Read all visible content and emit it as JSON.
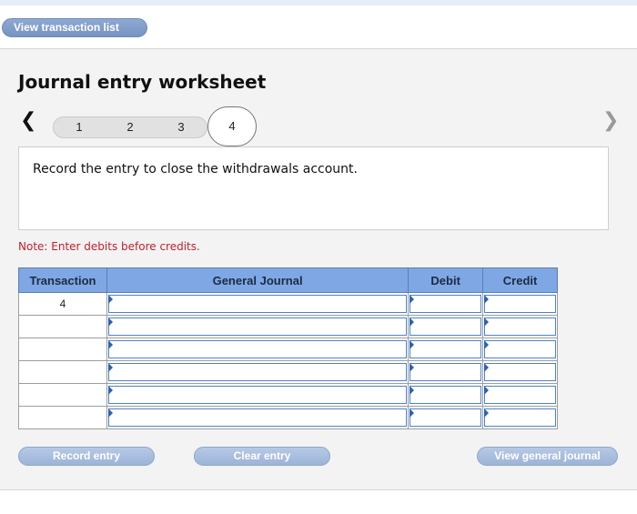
{
  "toolbar": {
    "view_transaction_list": "View transaction list"
  },
  "worksheet": {
    "title": "Journal entry worksheet",
    "steps": [
      "1",
      "2",
      "3",
      "4"
    ],
    "active_step": "4",
    "instruction": "Record the entry to close the withdrawals account.",
    "note": "Note: Enter debits before credits."
  },
  "table": {
    "headers": {
      "transaction": "Transaction",
      "general_journal": "General Journal",
      "debit": "Debit",
      "credit": "Credit"
    },
    "rows": [
      {
        "transaction": "4"
      },
      {
        "transaction": ""
      },
      {
        "transaction": ""
      },
      {
        "transaction": ""
      },
      {
        "transaction": ""
      },
      {
        "transaction": ""
      }
    ]
  },
  "buttons": {
    "record_entry": "Record entry",
    "clear_entry": "Clear entry",
    "view_general_journal": "View general journal"
  },
  "icons": {
    "prev": "chevron-left-icon",
    "next": "chevron-right-icon"
  },
  "colors": {
    "header": "#7fa7e3",
    "note": "#c0222b",
    "button": "#9db4d8"
  }
}
